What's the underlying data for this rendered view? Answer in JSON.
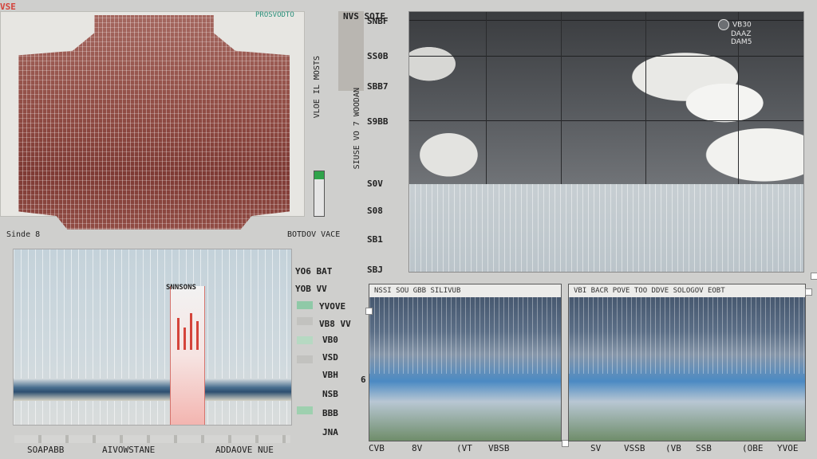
{
  "heatmap": {
    "title": "VSE",
    "footer_left": "Sinde 8",
    "footer_right": "BOTDOV VACE",
    "scale_label": "VLOE IL MOSTS",
    "side_label": "SIUSE VO 7 WOODAN"
  },
  "top_header": {
    "left": "PROSVODTO",
    "right": "NVS SOIE"
  },
  "sky_chart": {
    "y_ticks": [
      "SNBF",
      "SS0B",
      "SBB7",
      "S9BB",
      "S0V",
      "S08",
      "SB1",
      "SBJ"
    ],
    "legend": [
      "VB30",
      "DAAZ",
      "DAM5"
    ]
  },
  "bottom_left": {
    "popup_label": "SNNSONS",
    "side_labels": [
      "YO6 BAT",
      "YOB VV",
      "YVOVE",
      "VB8 VV",
      "VB0",
      "VSD",
      "VBH",
      "NSB",
      "BBB",
      "JNA"
    ],
    "bottom_labels": [
      "SOAPABB",
      "AIVOWSTANE",
      "ADDAOVE NUE"
    ]
  },
  "bottom_middle": {
    "header": "NSSI SOU GBB SILIVUB",
    "bottom_labels": [
      "CVB",
      "8V",
      "(VT",
      "VBSB"
    ],
    "side_label": "6"
  },
  "bottom_right": {
    "header": "VBI BACR POVE TOO DDVE SOLOGOV EOBT",
    "bottom_labels": [
      "SV",
      "VSSB",
      "(VB",
      "SSB",
      "(OBE",
      "YVOE"
    ]
  },
  "colors": {
    "accent_red": "#d4423a",
    "heat": "#8f4b43",
    "green": "#2fa34a"
  }
}
